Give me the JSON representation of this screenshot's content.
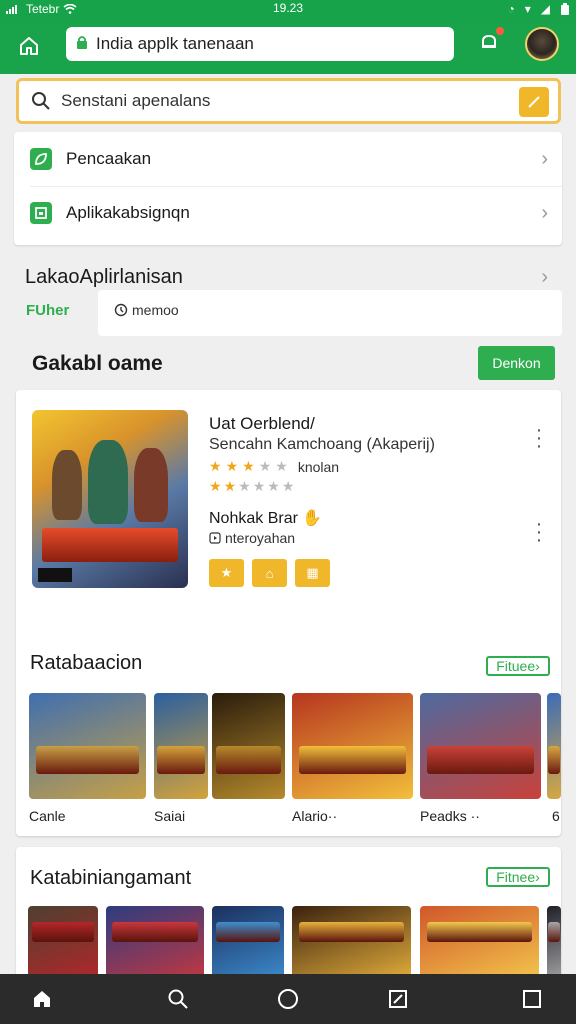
{
  "statusbar": {
    "carrier": "Tetebr",
    "time": "19.23"
  },
  "appbar": {
    "url_text": "India applk tanenaan"
  },
  "search": {
    "placeholder": "Senstani apenalans"
  },
  "menu": {
    "items": [
      {
        "label": "Pencaakan",
        "icon": "leaf-icon"
      },
      {
        "label": "Aplikakabsignqn",
        "icon": "app-icon"
      }
    ]
  },
  "last_apps": {
    "title": "LakaoAplirlanisan",
    "filter_label": "FUher",
    "chip_label": "memoo"
  },
  "section": {
    "title": "Gakabl oame",
    "button_label": "Denkon"
  },
  "featured": {
    "title": "Uat Oerblend/",
    "subtitle": "Sencahn Kamchoang (Akaperij)",
    "rating_label": "knolan",
    "stars1": [
      1,
      1,
      1,
      0,
      0
    ],
    "stars2": [
      1,
      1,
      0,
      0,
      0,
      0
    ],
    "title2": "Nohkak Brar",
    "subtitle2": "nteroyahan"
  },
  "recommend": {
    "title": "Ratabaacion",
    "filter_label": "Fituee",
    "items": [
      {
        "label": "Canle",
        "color_a": "#3f6fb0",
        "color_b": "#c7a046"
      },
      {
        "label": "Saiai",
        "color_a": "#2b5f9e",
        "color_b": "#d4a33c"
      },
      {
        "label": "",
        "color_a": "#2a1c0c",
        "color_b": "#b58a2c"
      },
      {
        "label": "Alario··",
        "color_a": "#b6361f",
        "color_b": "#f2bf3b"
      },
      {
        "label": "Peadks ··",
        "color_a": "#4d6aa0",
        "color_b": "#c9423a"
      },
      {
        "label": "6",
        "color_a": "#3b6cb7",
        "color_b": "#d6a842"
      }
    ]
  },
  "category": {
    "title": "Katabiniangamant",
    "filter_label": "Fitnee",
    "items": [
      {
        "color_a": "#4d4030",
        "color_b": "#b7262a"
      },
      {
        "color_a": "#2c3c80",
        "color_b": "#c8373e"
      },
      {
        "color_a": "#1c2f5e",
        "color_b": "#3d8fd0"
      },
      {
        "color_a": "#3b220f",
        "color_b": "#e7b23d"
      },
      {
        "color_a": "#d1572a",
        "color_b": "#f4c94d"
      },
      {
        "color_a": "#20202a",
        "color_b": "#a8a8a8"
      }
    ]
  },
  "colors": {
    "primary": "#19a34a",
    "accent": "#f1b72a"
  }
}
